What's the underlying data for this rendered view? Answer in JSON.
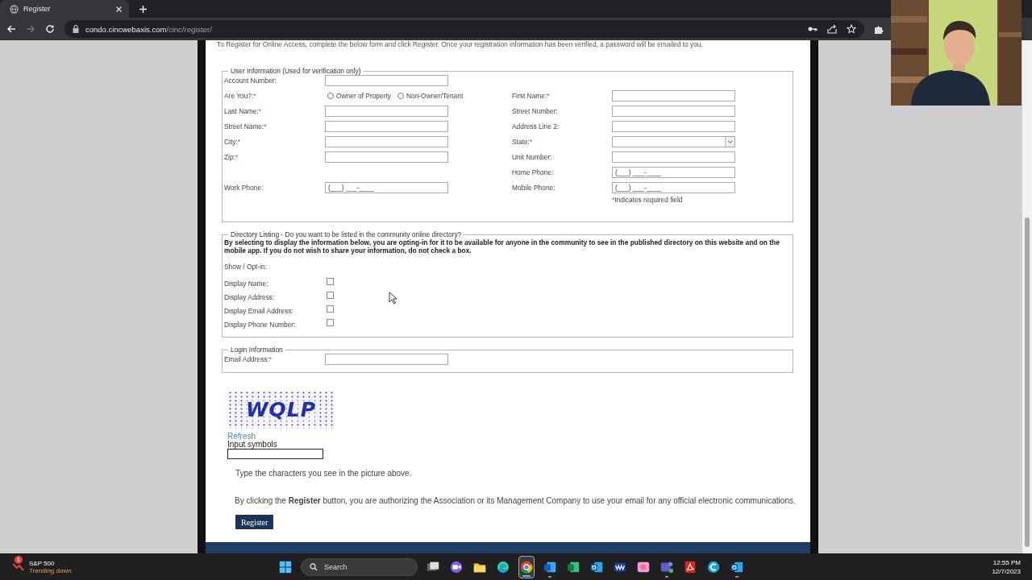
{
  "browser": {
    "tab_title": "Register",
    "url_host": "condo.cincwebaxis.com",
    "url_path": "/cinc/register/"
  },
  "intro": "To Register for Online Access, complete the below form and click Register. Once your registration information has been verified, a password will be emailed to you.",
  "user_info": {
    "legend": "User Information (Used for verification only)",
    "rows": [
      {
        "left": {
          "label": "Account Number:",
          "kind": "text"
        }
      },
      {
        "left": {
          "label": "Are You?:",
          "mark": "*",
          "kind": "radio",
          "options": [
            {
              "label": "Owner of Property",
              "selected": false
            },
            {
              "label": "Non-Owner/Tenant",
              "selected": false
            }
          ]
        },
        "right": {
          "label": "First Name:",
          "mark": "*",
          "kind": "text"
        }
      },
      {
        "left": {
          "label": "Last Name:",
          "mark": "*",
          "kind": "text"
        },
        "right": {
          "label": "Street Number:",
          "kind": "text"
        }
      },
      {
        "left": {
          "label": "Street Name:",
          "mark": "*",
          "kind": "text"
        },
        "right": {
          "label": "Address Line 2:",
          "kind": "text"
        }
      },
      {
        "left": {
          "label": "City:",
          "mark": "*",
          "kind": "text"
        },
        "right": {
          "label": "State:",
          "mark": "*",
          "kind": "select"
        }
      },
      {
        "left": {
          "label": "Zip:",
          "mark": "*",
          "kind": "text"
        },
        "right": {
          "label": "Unit Number:",
          "kind": "text"
        }
      },
      {
        "right": {
          "label": "Home Phone:",
          "kind": "phone",
          "value": "(___) ___-____"
        }
      },
      {
        "left": {
          "label": "Work Phone:",
          "kind": "phone",
          "value": "(___) ___-____"
        },
        "right": {
          "label": "Mobile Phone:",
          "kind": "phone",
          "value": "(___) ___-____"
        }
      }
    ],
    "note_mark": "*",
    "note": "Indicates required field"
  },
  "directory": {
    "legend": "Directory Listing - Do you want to be listed in the community online directory?",
    "notice": "By selecting to display the information below, you are opting-in for it to be available for anyone in the community to see in the published directory on this website and on the mobile app. If you do not wish to share your information, do not check a box.",
    "show_label": "Show / Opt-in:",
    "options": [
      {
        "label": "Display Name:",
        "checked": false
      },
      {
        "label": "Display Address:",
        "checked": false
      },
      {
        "label": "Display Email Address:",
        "checked": false
      },
      {
        "label": "Display Phone Number:",
        "checked": false
      }
    ]
  },
  "login": {
    "legend": "Login Information",
    "fields": [
      {
        "label": "Email Address:",
        "mark": "*",
        "kind": "text"
      }
    ]
  },
  "captcha": {
    "symbols": "WQLP",
    "refresh": "Refresh",
    "input_label": "Input symbols",
    "hint": "Type the characters you see in the picture above.",
    "consent": "By clicking the **Register** button, you are authorizing the Association or its Management Company to use your email for any official electronic communications.",
    "button": "Register"
  },
  "taskbar": {
    "widget": {
      "badge": "1",
      "title": "S&P 500",
      "subtitle": "Trending down"
    },
    "search": "Search",
    "apps": [
      {
        "kind": "start",
        "running": false,
        "selected": false
      },
      {
        "kind": "search"
      },
      {
        "kind": "taskview",
        "running": false,
        "selected": false
      },
      {
        "kind": "video",
        "running": false,
        "selected": false
      },
      {
        "kind": "folder",
        "running": false,
        "selected": false
      },
      {
        "kind": "swirl",
        "running": false,
        "selected": false
      },
      {
        "kind": "chrome",
        "running": true,
        "selected": true
      },
      {
        "kind": "word",
        "running": true,
        "selected": false
      },
      {
        "kind": "excel",
        "running": false,
        "selected": false
      },
      {
        "kind": "mail",
        "running": false,
        "selected": false
      },
      {
        "kind": "wave",
        "running": false,
        "selected": false
      },
      {
        "kind": "photos",
        "running": false,
        "selected": false
      },
      {
        "kind": "chat",
        "running": true,
        "selected": false
      },
      {
        "kind": "pdf",
        "running": false,
        "selected": false
      },
      {
        "kind": "ring",
        "running": false,
        "selected": false
      },
      {
        "kind": "mail",
        "running": true,
        "selected": false
      }
    ],
    "time": "12:55 PM",
    "date": "12/7/2023"
  }
}
